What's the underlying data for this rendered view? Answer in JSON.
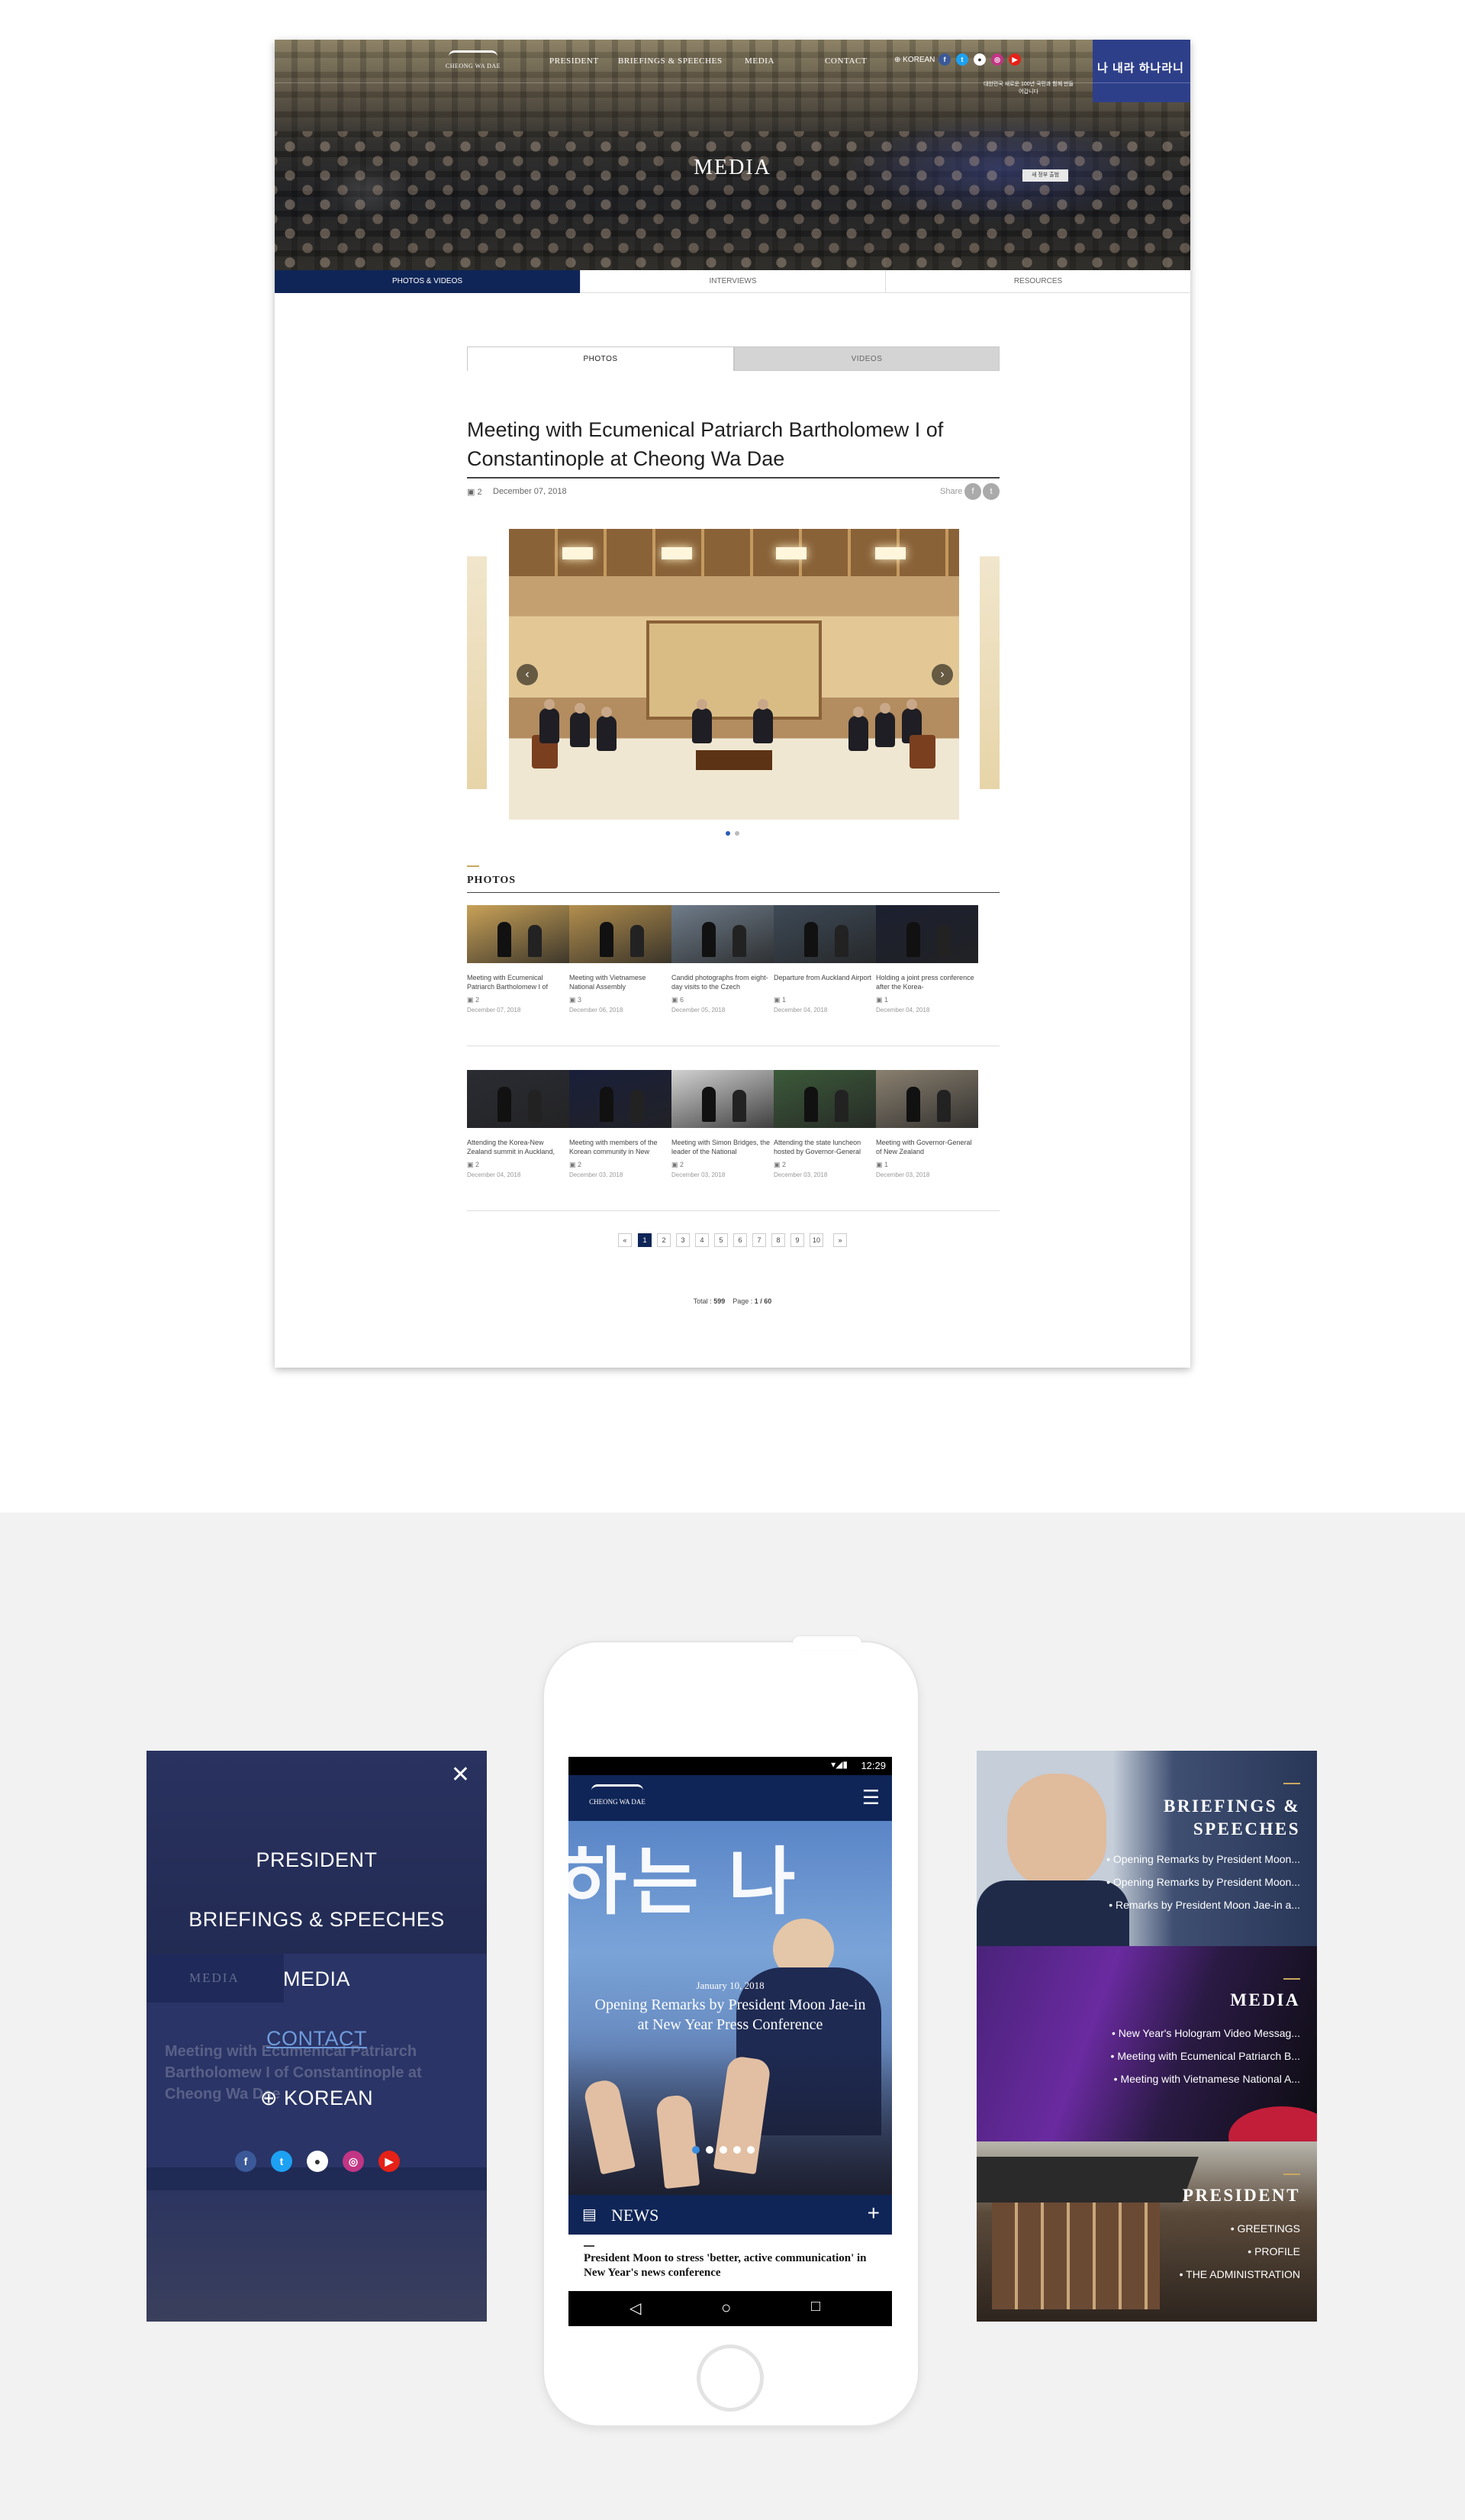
{
  "site": {
    "logo_text": "CHEONG WA DAE",
    "nav": [
      "PRESIDENT",
      "BRIEFINGS & SPEECHES",
      "MEDIA",
      "CONTACT"
    ],
    "language": "KOREAN",
    "social_icons": [
      "facebook-icon",
      "twitter-icon",
      "flickr-icon",
      "instagram-icon",
      "youtube-icon"
    ],
    "hero_title": "MEDIA",
    "hero_caption": "대한민국 새로운 100년 국민과 함께 만들어갑니다",
    "hero_banner": "나 내라 하나라니",
    "hero_sign": "새 정부 출범"
  },
  "sub_tabs": [
    "PHOTOS & VIDEOS",
    "INTERVIEWS",
    "RESOURCES"
  ],
  "media_tabs": [
    "PHOTOS",
    "VIDEOS"
  ],
  "article": {
    "title": "Meeting with Ecumenical Patriarch Bartholomew I of Constantinople at Cheong Wa Dae",
    "count": "2",
    "date": "December 07, 2018",
    "share_label": "Share"
  },
  "photos_section": {
    "label": "PHOTOS",
    "row1": [
      {
        "caption": "Meeting with Ecumenical Patriarch Bartholomew I of",
        "count": "2",
        "date": "December 07, 2018"
      },
      {
        "caption": "Meeting with Vietnamese National Assembly",
        "count": "3",
        "date": "December 06, 2018"
      },
      {
        "caption": "Candid photographs from eight-day visits to the Czech",
        "count": "6",
        "date": "December 05, 2018"
      },
      {
        "caption": "Departure from Auckland Airport",
        "count": "1",
        "date": "December 04, 2018"
      },
      {
        "caption": "Holding a joint press conference after the Korea-",
        "count": "1",
        "date": "December 04, 2018"
      }
    ],
    "row2": [
      {
        "caption": "Attending the Korea-New Zealand summit in Auckland,",
        "count": "2",
        "date": "December 04, 2018"
      },
      {
        "caption": "Meeting with members of the Korean community in New",
        "count": "2",
        "date": "December 03, 2018"
      },
      {
        "caption": "Meeting with Simon Bridges, the leader of the National",
        "count": "2",
        "date": "December 03, 2018"
      },
      {
        "caption": "Attending the state luncheon hosted by Governor-General",
        "count": "2",
        "date": "December 03, 2018"
      },
      {
        "caption": "Meeting with Governor-General of New Zealand",
        "count": "1",
        "date": "December 03, 2018"
      }
    ]
  },
  "pagination": {
    "first": "«",
    "pages": [
      "1",
      "2",
      "3",
      "4",
      "5",
      "6",
      "7",
      "8",
      "9",
      "10"
    ],
    "last": "»",
    "total_label": "Total :",
    "total_value": "599",
    "page_label": "Page :",
    "page_value": "1 / 60"
  },
  "mobile_menu": {
    "items": [
      "PRESIDENT",
      "BRIEFINGS & SPEECHES",
      "MEDIA",
      "CONTACT"
    ],
    "language": "KOREAN",
    "bg_media_label": "MEDIA",
    "bg_title": "Meeting with Ecumenical Patriarch Bartholomew I of Constantinople at Cheong Wa Dae"
  },
  "phone": {
    "time": "12:29",
    "logo_text": "CHEONG WA DAE",
    "hero_big_text": "하는 나",
    "hero_date": "January 10, 2018",
    "hero_title": "Opening Remarks by President Moon Jae-in at New Year Press Conference",
    "news_label": "NEWS",
    "news_headline": "President Moon to stress 'better, active communication' in New Year's news conference"
  },
  "mobile_sections": [
    {
      "title": "BRIEFINGS & SPEECHES",
      "items": [
        "Opening Remarks by President Moon...",
        "Opening Remarks by President Moon...",
        "Remarks by President Moon Jae-in a..."
      ]
    },
    {
      "title": "MEDIA",
      "items": [
        "New Year's Hologram Video Messag...",
        "Meeting with Ecumenical Patriarch B...",
        "Meeting with Vietnamese National A..."
      ]
    },
    {
      "title": "PRESIDENT",
      "items": [
        "GREETINGS",
        "PROFILE",
        "THE ADMINISTRATION"
      ]
    }
  ]
}
